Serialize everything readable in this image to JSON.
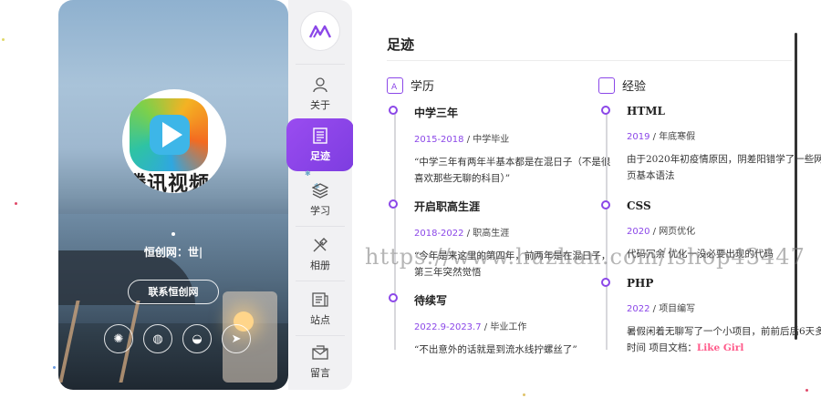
{
  "profile": {
    "avatar_brand_text": "腾讯视频",
    "name_line": "恒创网：世|",
    "contact_button": "联系恒创网"
  },
  "socials": [
    {
      "icon": "weibo-icon",
      "glyph": "✺"
    },
    {
      "icon": "wechat-icon",
      "glyph": "◍"
    },
    {
      "icon": "qq-icon",
      "glyph": "◒"
    },
    {
      "icon": "location-icon",
      "glyph": "➤"
    }
  ],
  "nav": {
    "items": [
      {
        "label": "关于",
        "icon": "user-icon"
      },
      {
        "label": "足迹",
        "icon": "document-icon",
        "active": true
      },
      {
        "label": "学习",
        "icon": "layers-icon"
      },
      {
        "label": "相册",
        "icon": "tools-icon"
      },
      {
        "label": "站点",
        "icon": "news-icon"
      },
      {
        "label": "留言",
        "icon": "envelope-icon"
      }
    ]
  },
  "main": {
    "title": "足迹",
    "education": {
      "heading": "学历",
      "entries": [
        {
          "title": "中学三年",
          "years": "2015-2018",
          "tag": "中学毕业",
          "desc": "“中学三年有两年半基本都是在混日子（不是很喜欢那些无聊的科目）”"
        },
        {
          "title": "开启职高生涯",
          "years": "2018-2022",
          "tag": "职高生涯",
          "desc": "“今年是来这里的第四年，前两年是在混日子，第三年突然觉悟"
        },
        {
          "title": "待续写",
          "years": "2022.9-2023.7",
          "tag": "毕业工作",
          "desc": "“不出意外的话就是到流水线拧螺丝了”"
        }
      ]
    },
    "experience": {
      "heading": "经验",
      "entries": [
        {
          "title": "HTML",
          "years": "2019",
          "tag": "年底寒假",
          "desc": "由于2020年初疫情原因，阴差阳错学了一些网页基本语法"
        },
        {
          "title": "CSS",
          "years": "2020",
          "tag": "网页优化",
          "desc": "代码冗余 优化一没必要出现的代码"
        },
        {
          "title": "PHP",
          "years": "2022",
          "tag": "项目编写",
          "desc": "暑假闲着无聊写了一个小项目，前前后后6天多时间 项目文档：",
          "link": "Like Girl"
        }
      ]
    }
  },
  "watermark": "https://www.huzhan.com/ishop43447",
  "colors": {
    "accent": "#8b47e8",
    "link": "#ff5a8a"
  }
}
